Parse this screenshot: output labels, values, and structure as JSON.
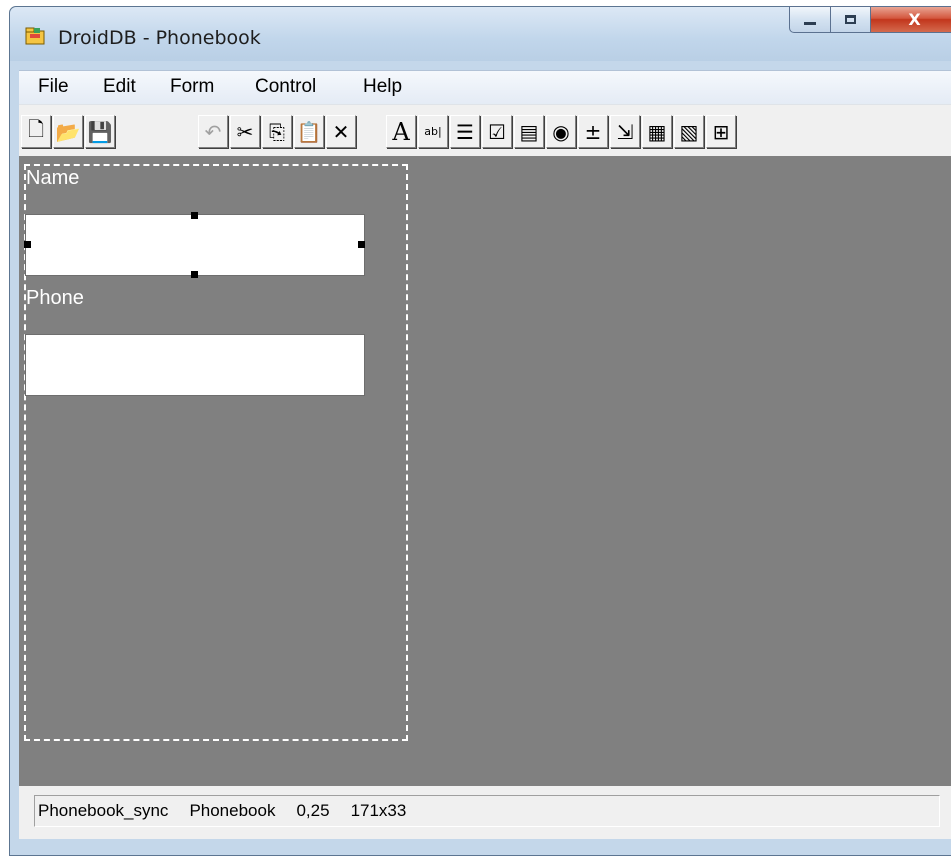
{
  "window": {
    "title": "DroidDB - Phonebook",
    "close_glyph": "X"
  },
  "menu": [
    "File",
    "Edit",
    "Form",
    "Control",
    "Help"
  ],
  "toolbar": {
    "buttons": [
      {
        "icon": "new-document-icon",
        "glyph": "🗋"
      },
      {
        "icon": "open-folder-icon",
        "glyph": "📂"
      },
      {
        "icon": "save-icon",
        "glyph": "💾"
      },
      {
        "icon": "undo-icon",
        "glyph": "↶",
        "disabled": true
      },
      {
        "icon": "cut-icon",
        "glyph": "✂"
      },
      {
        "icon": "copy-icon",
        "glyph": "⎘"
      },
      {
        "icon": "paste-icon",
        "glyph": "📋",
        "disabled": true
      },
      {
        "icon": "delete-icon",
        "glyph": "✕"
      },
      {
        "icon": "label-tool-icon",
        "glyph": "A"
      },
      {
        "icon": "textbox-tool-icon",
        "glyph": "ab|"
      },
      {
        "icon": "multiline-tool-icon",
        "glyph": "☰"
      },
      {
        "icon": "checkbox-tool-icon",
        "glyph": "☑"
      },
      {
        "icon": "listbox-tool-icon",
        "glyph": "▤"
      },
      {
        "icon": "radio-tool-icon",
        "glyph": "◉"
      },
      {
        "icon": "spinner-tool-icon",
        "glyph": "±"
      },
      {
        "icon": "combobox-tool-icon",
        "glyph": "⇲"
      },
      {
        "icon": "grid-tool-icon",
        "glyph": "▦"
      },
      {
        "icon": "tree-tool-icon",
        "glyph": "▧"
      },
      {
        "icon": "table-tool-icon",
        "glyph": "⊞"
      }
    ]
  },
  "form": {
    "fields": [
      {
        "label": "Name",
        "value": ""
      },
      {
        "label": "Phone",
        "value": ""
      }
    ]
  },
  "status": {
    "sync": "Phonebook_sync",
    "table": "Phonebook",
    "position": "0,25",
    "size": "171x33"
  },
  "colors": {
    "canvas": "#808080",
    "menu_bg": "#f0f0f0",
    "close_button": "#c2361c"
  }
}
